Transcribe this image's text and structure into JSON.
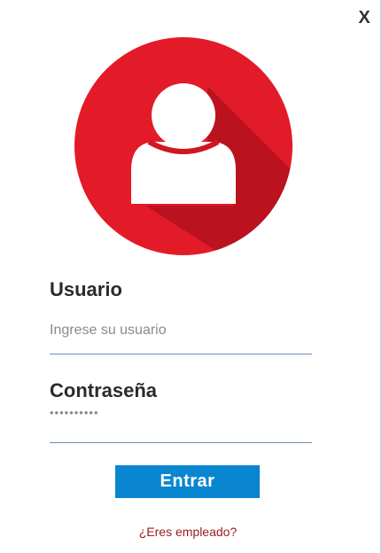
{
  "window": {
    "close_label": "X"
  },
  "avatar": {
    "icon": "user-icon",
    "color": "#e31b28"
  },
  "form": {
    "username_label": "Usuario",
    "username_placeholder": "Ingrese su usuario",
    "username_value": "",
    "password_label": "Contraseña",
    "password_value": "••••••••••",
    "submit_label": "Entrar",
    "employee_link": "¿Eres empleado?"
  },
  "colors": {
    "accent_button": "#0a86d0",
    "input_underline": "#6b8cb8",
    "link": "#9a1a1a"
  }
}
